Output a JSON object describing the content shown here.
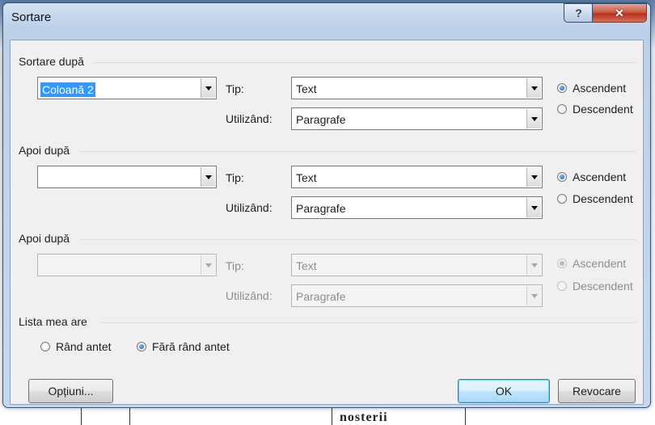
{
  "window": {
    "title": "Sortare",
    "help_glyph": "?",
    "close_glyph": "✕"
  },
  "sort_by": {
    "heading": "Sortare după",
    "column_value": "Coloană 2",
    "type_label": "Tip:",
    "type_value": "Text",
    "using_label": "Utilizând:",
    "using_value": "Paragrafe",
    "ascending_label": "Ascendent",
    "descending_label": "Descendent",
    "order_selected": "ascending"
  },
  "then_by_1": {
    "heading": "Apoi după",
    "column_value": "",
    "type_label": "Tip:",
    "type_value": "Text",
    "using_label": "Utilizând:",
    "using_value": "Paragrafe",
    "ascending_label": "Ascendent",
    "descending_label": "Descendent",
    "order_selected": "ascending"
  },
  "then_by_2": {
    "heading": "Apoi după",
    "column_value": "",
    "type_label": "Tip:",
    "type_value": "Text",
    "using_label": "Utilizând:",
    "using_value": "Paragrafe",
    "ascending_label": "Ascendent",
    "descending_label": "Descendent",
    "order_selected": "ascending",
    "disabled": true
  },
  "list_has": {
    "heading": "Lista mea are",
    "header_row_label": "Rând antet",
    "no_header_row_label": "Fără rând antet",
    "selected": "no_header_row"
  },
  "buttons": {
    "options": "Opțiuni...",
    "ok": "OK",
    "cancel": "Revocare"
  },
  "background_text": "nosterii"
}
